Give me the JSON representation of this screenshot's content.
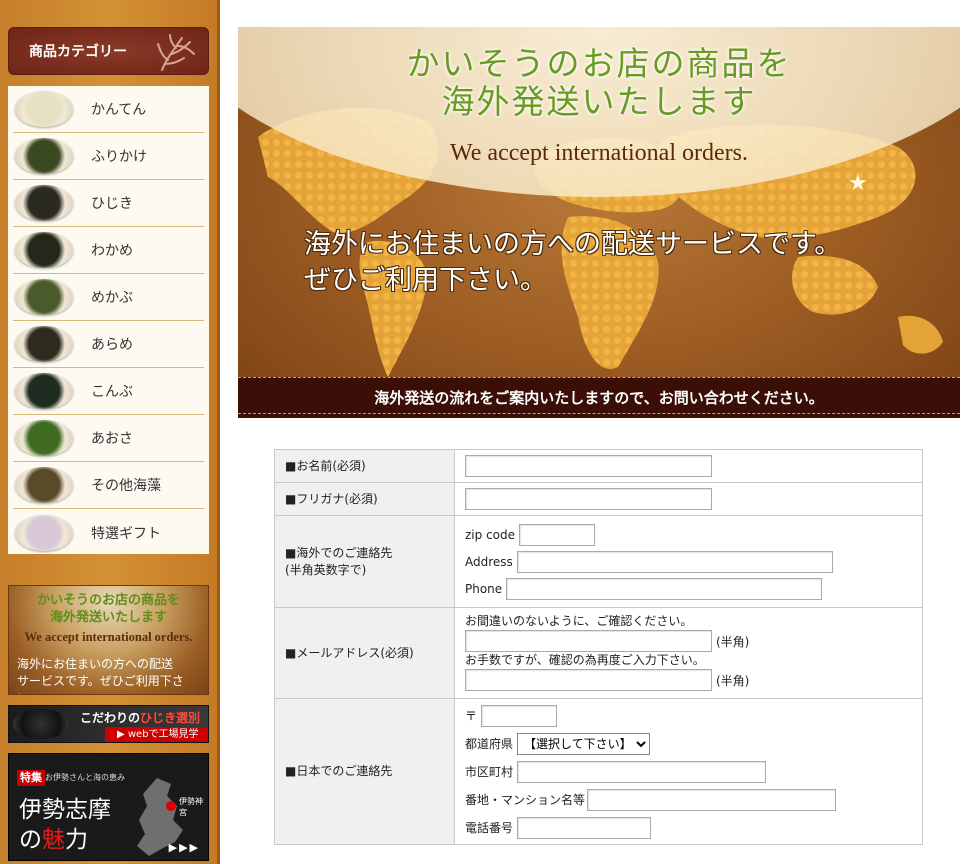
{
  "sidebar": {
    "category_header": "商品カテゴリー",
    "categories": [
      {
        "label": "かんてん",
        "icon": "kanten-thumbnail",
        "color": "#e8e0c4"
      },
      {
        "label": "ふりかけ",
        "icon": "furikake-thumbnail",
        "color": "#3a4a20"
      },
      {
        "label": "ひじき",
        "icon": "hijiki-thumbnail",
        "color": "#2a2a22"
      },
      {
        "label": "わかめ",
        "icon": "wakame-thumbnail",
        "color": "#23281a"
      },
      {
        "label": "めかぶ",
        "icon": "mekabu-thumbnail",
        "color": "#4a5a2a"
      },
      {
        "label": "あらめ",
        "icon": "arame-thumbnail",
        "color": "#2d2a1e"
      },
      {
        "label": "こんぶ",
        "icon": "konbu-thumbnail",
        "color": "#1e2b20"
      },
      {
        "label": "あおさ",
        "icon": "aosa-thumbnail",
        "color": "#3f6a22"
      },
      {
        "label": "その他海藻",
        "icon": "other-seaweed-thumbnail",
        "color": "#5a4a2a"
      },
      {
        "label": "特選ギフト",
        "icon": "gift-thumbnail",
        "color": "#d8c8d8"
      }
    ],
    "ship_banner": {
      "title_line1": "かいそうのお店の商品を",
      "title_line2": "海外発送いたします",
      "english": "We accept international orders.",
      "desc_line1": "海外にお住まいの方への配送",
      "desc_line2": "サービスです。ぜひご利用下さい。"
    },
    "hijiki_banner": {
      "title_prefix": "こだわりの",
      "title_highlight": "ひじき選別",
      "subtitle": "▶ webで工場見学"
    },
    "ise_banner": {
      "tag": "特集",
      "small": "お伊勢さんと海の恵み",
      "big_line1": "伊勢志摩",
      "big_line2_a": "の",
      "big_line2_b": "魅",
      "big_line2_c": "力",
      "shrine": "伊勢神宮",
      "arrows": "▶▶▶"
    }
  },
  "banner": {
    "title_line1": "かいそうのお店の商品を",
    "title_line2": "海外発送いたします",
    "english": "We accept international orders.",
    "desc_line1": "海外にお住まいの方への配送サービスです。",
    "desc_line2": "ぜひご利用下さい。",
    "strip": "海外発送の流れをご案内いたしますので、お問い合わせください。"
  },
  "form": {
    "name_label": "■お名前(必須)",
    "furigana_label": "■フリガナ(必須)",
    "overseas_label_1": "■海外でのご連絡先",
    "overseas_label_2": "(半角英数字で)",
    "zip_label": "zip code",
    "address_label": "Address",
    "phone_label": "Phone",
    "email_label": "■メールアドレス(必須)",
    "email_note1": "お間違いのないように、ご確認ください。",
    "email_note2": "お手数ですが、確認の為再度ご入力下さい。",
    "halfwidth": "(半角)",
    "japan_label": "■日本でのご連絡先",
    "postal_mark": "〒",
    "prefecture_label": "都道府県",
    "prefecture_selected": "【選択して下さい】",
    "city_label": "市区町村",
    "street_label": "番地・マンション名等",
    "tel_label": "電話番号"
  }
}
